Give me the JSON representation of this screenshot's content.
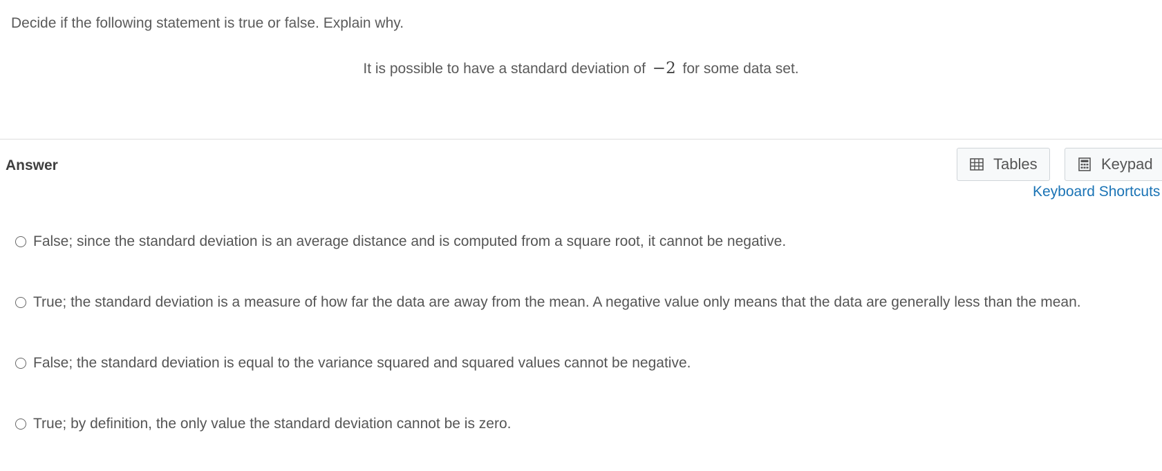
{
  "question": {
    "instruction": "Decide if the following statement is true or false. Explain why.",
    "statement_before": "It is possible to have a standard deviation of",
    "statement_math": "−2",
    "statement_after": "for some data set."
  },
  "answer": {
    "label": "Answer",
    "tables_label": "Tables",
    "keypad_label": "Keypad",
    "shortcuts_label": "Keyboard Shortcuts",
    "options": [
      "False; since the standard deviation is an average distance and is computed from a square root, it cannot be negative.",
      "True; the standard deviation is a measure of how far the data are away from the mean. A negative value only means that the data are generally less than the mean.",
      "False; the standard deviation is equal to the variance squared and squared values cannot be negative.",
      "True; by definition, the only value the standard deviation cannot be is zero."
    ]
  },
  "icons": {
    "tables": "table-icon",
    "keypad": "calculator-icon"
  },
  "colors": {
    "link": "#1a73b5",
    "text": "#555555",
    "divider": "#dedede"
  }
}
